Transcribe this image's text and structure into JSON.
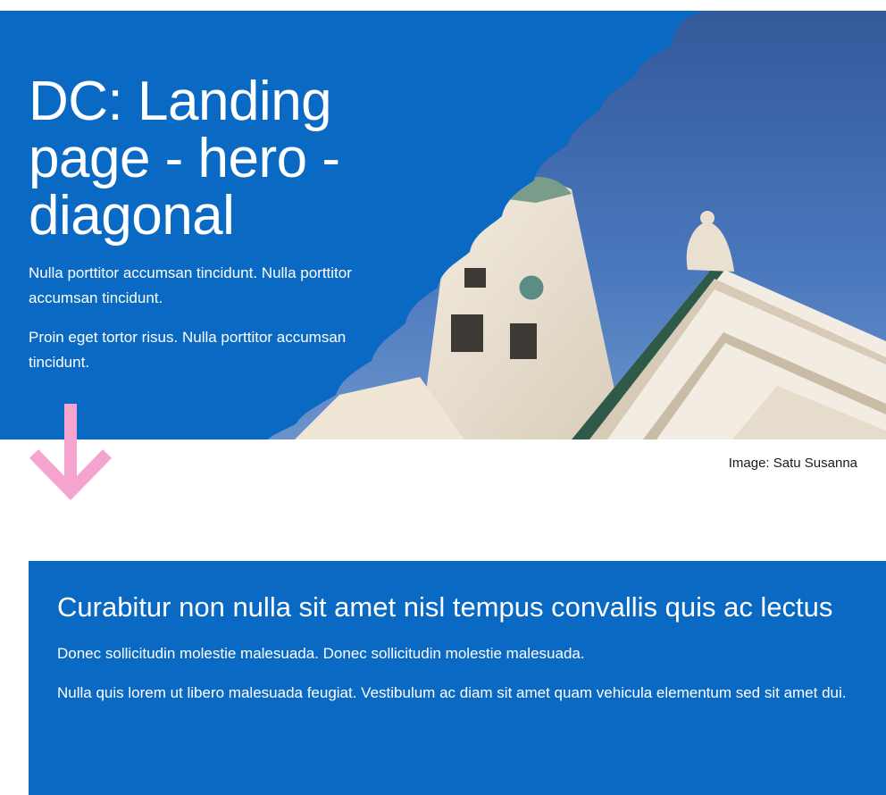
{
  "hero": {
    "title": "DC: Landing page - hero - diagonal",
    "paragraphs": [
      "Nulla porttitor accumsan tincidunt. Nulla porttitor accumsan tincidunt.",
      "Proin eget tortor risus. Nulla porttitor accumsan tincidunt."
    ],
    "image_subject": "Helsinki Cathedral dome and pediment against blue sky",
    "caption": "Image: Satu Susanna"
  },
  "arrow": {
    "icon": "arrow-down-icon",
    "color": "#f5a3cf"
  },
  "info_box": {
    "title": "Curabitur non nulla sit amet nisl tempus convallis quis ac lectus",
    "paragraphs": [
      "Donec sollicitudin molestie malesuada. Donec sollicitudin molestie malesuada.",
      "Nulla quis lorem ut libero malesuada feugiat. Vestibulum ac diam sit amet quam vehicula elementum sed sit amet dui."
    ]
  },
  "colors": {
    "brand_blue": "#0a6ac3",
    "sky": "#3c6fb5",
    "text_on_blue": "#ffffff",
    "arrow_pink": "#f5a3cf"
  }
}
